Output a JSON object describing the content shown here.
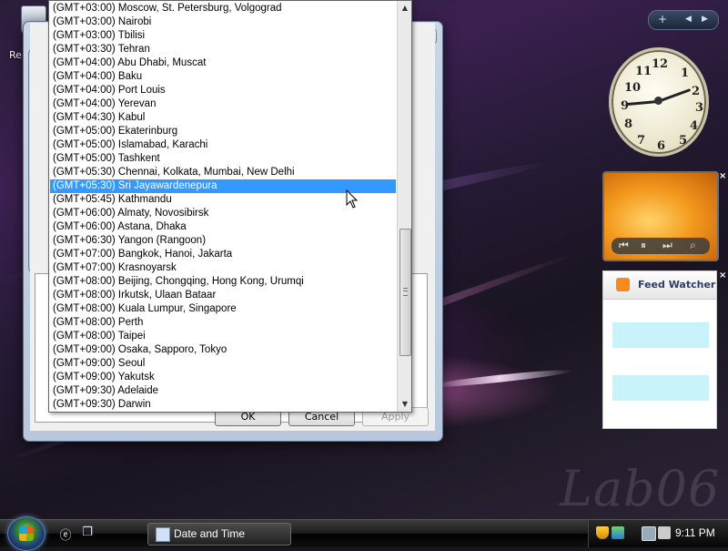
{
  "desktop": {
    "recycle_bin_label": "Re",
    "watermark": "Lab06"
  },
  "sidebar": {
    "feed_title": "Feed Watcher"
  },
  "dialog": {
    "ok_label": "OK",
    "cancel_label": "Cancel",
    "apply_label": "Apply"
  },
  "timezone_list": {
    "selected_index": 13,
    "items": [
      "(GMT+03:00) Moscow, St. Petersburg, Volgograd",
      "(GMT+03:00) Nairobi",
      "(GMT+03:00) Tbilisi",
      "(GMT+03:30) Tehran",
      "(GMT+04:00) Abu Dhabi, Muscat",
      "(GMT+04:00) Baku",
      "(GMT+04:00) Port Louis",
      "(GMT+04:00) Yerevan",
      "(GMT+04:30) Kabul",
      "(GMT+05:00) Ekaterinburg",
      "(GMT+05:00) Islamabad, Karachi",
      "(GMT+05:00) Tashkent",
      "(GMT+05:30) Chennai, Kolkata, Mumbai, New Delhi",
      "(GMT+05:30) Sri Jayawardenepura",
      "(GMT+05:45) Kathmandu",
      "(GMT+06:00) Almaty, Novosibirsk",
      "(GMT+06:00) Astana, Dhaka",
      "(GMT+06:30) Yangon (Rangoon)",
      "(GMT+07:00) Bangkok, Hanoi, Jakarta",
      "(GMT+07:00) Krasnoyarsk",
      "(GMT+08:00) Beijing, Chongqing, Hong Kong, Urumqi",
      "(GMT+08:00) Irkutsk, Ulaan Bataar",
      "(GMT+08:00) Kuala Lumpur, Singapore",
      "(GMT+08:00) Perth",
      "(GMT+08:00) Taipei",
      "(GMT+09:00) Osaka, Sapporo, Tokyo",
      "(GMT+09:00) Seoul",
      "(GMT+09:00) Yakutsk",
      "(GMT+09:30) Adelaide",
      "(GMT+09:30) Darwin"
    ]
  },
  "taskbar": {
    "task_label": "Date and Time",
    "time": "9:11 PM"
  },
  "icons": {
    "start": "windows-start-orb",
    "quick_launch": [
      "internet-explorer-icon",
      "switch-windows-icon"
    ],
    "tray": [
      "security-shield-icon",
      "network-icon",
      "network-disconnected-icon",
      "volume-muted-icon"
    ]
  },
  "colors": {
    "selection": "#3399ff",
    "taskbar": "#1c1c1c"
  }
}
